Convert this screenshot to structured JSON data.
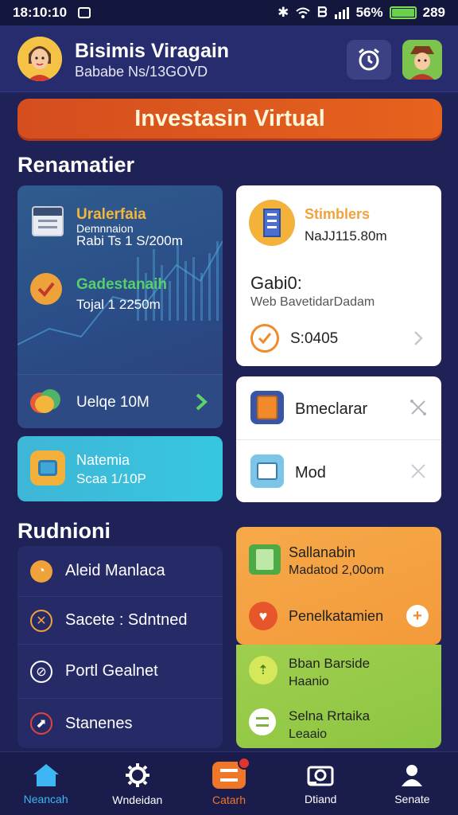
{
  "status": {
    "time": "18:10:10",
    "battery": "56%",
    "right_time": "289"
  },
  "header": {
    "name": "Bisimis Viragain",
    "id": "Bababe Ns/13GOVD"
  },
  "banner": "Investasin Virtual",
  "sections": {
    "recommendations": "Renamatier",
    "recent": "Rudnioni"
  },
  "blue_card": {
    "item1_title": "Uralerfaia",
    "item1_sub1": "Demnnaion",
    "item1_sub2": "Rabi Ts 1 S/200m",
    "item2_title": "Gadestanaih",
    "item2_sub": "Tojal 1 2250m",
    "footer": "Uelqe 10M"
  },
  "teal_card": {
    "title": "Natemia",
    "sub": "Scaa 1/10P"
  },
  "white_card": {
    "title": "Stimblers",
    "amount": "NaJJ115.80m",
    "heading": "Gabi0:",
    "desc": "Web BavetidarDadam",
    "check_label": "S:0405"
  },
  "small_cards": [
    {
      "label": "Bmeclarar"
    },
    {
      "label": "Mod"
    }
  ],
  "recent_list": [
    {
      "label": "Aleid Manlaca"
    },
    {
      "label": "Sacete : Sdntned"
    },
    {
      "label": "Portl Gealnet"
    },
    {
      "label": "Stanenes"
    }
  ],
  "orange_card": {
    "item1_title": "Sallanabin",
    "item1_sub": "Madatod 2,00om",
    "item2_title": "Penelkatamien"
  },
  "green_card": {
    "item1_title": "Bban Barside",
    "item1_sub": "Haanio",
    "item2_title": "Selna Rrtaika",
    "item2_sub": "Leaaio"
  },
  "nav": [
    {
      "label": "Neancah"
    },
    {
      "label": "Wndeidan"
    },
    {
      "label": "Catarh"
    },
    {
      "label": "Dtiand"
    },
    {
      "label": "Senate"
    }
  ],
  "colors": {
    "accent": "#e6621d",
    "nav_active": "#3db6f3"
  }
}
